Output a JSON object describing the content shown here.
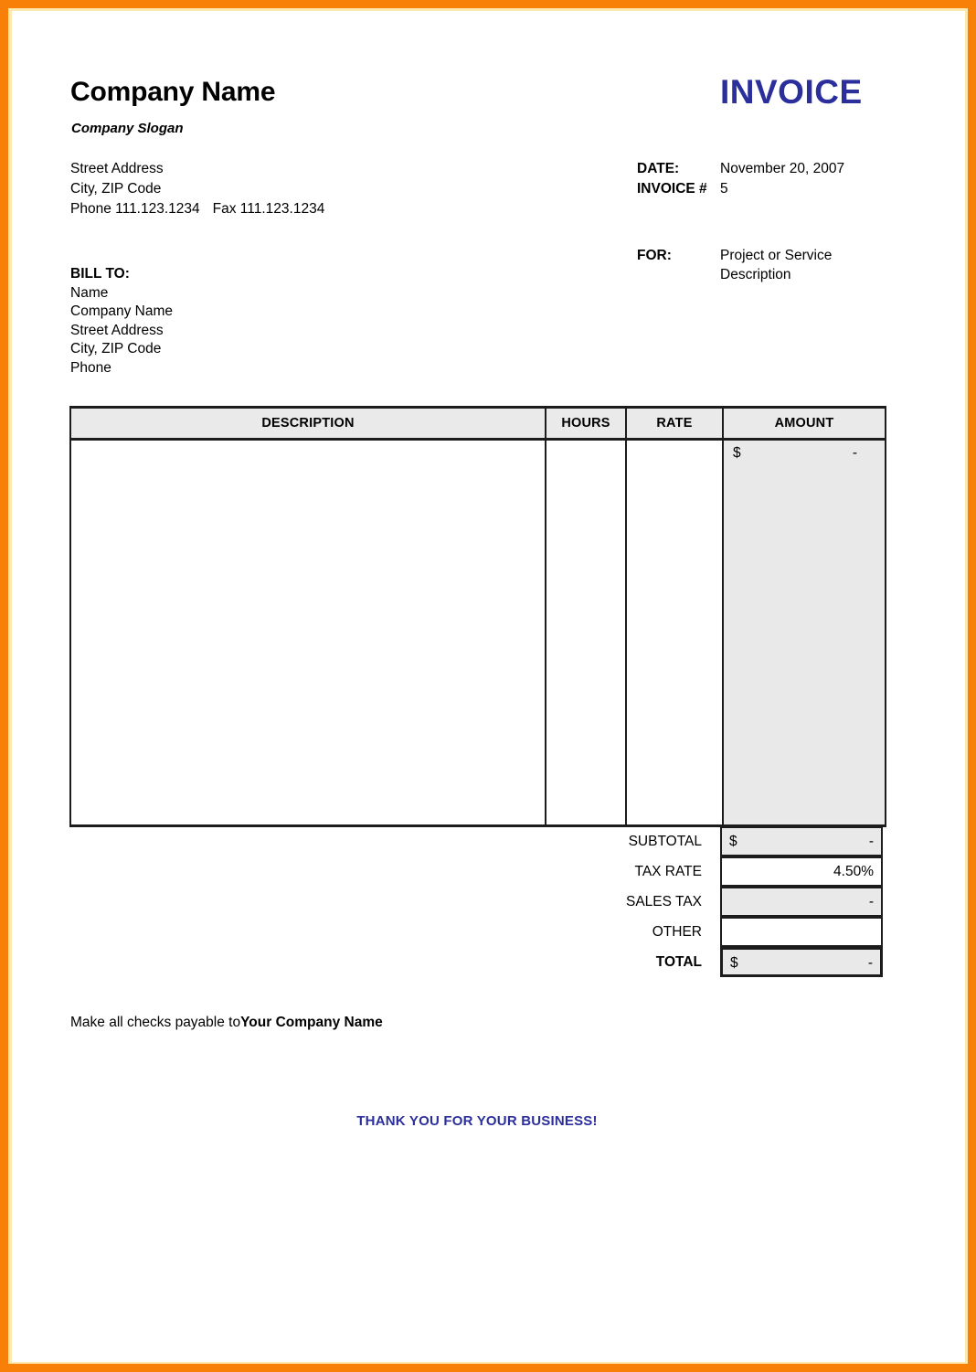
{
  "document": {
    "type": "invoice",
    "accent_orange": "#f98008",
    "accent_blue": "#2b2f9c",
    "shaded_cell_color": "#e9e9e9",
    "header_fill_color": "#eaeaea"
  },
  "header": {
    "company_name": "Company Name",
    "company_slogan": "Company Slogan",
    "invoice_title": "INVOICE",
    "address": {
      "street": "Street Address",
      "city_zip": "City, ZIP Code",
      "phone_label": "Phone 111.123.1234",
      "fax_label": "Fax 111.123.1234"
    }
  },
  "meta": {
    "date_label": "DATE:",
    "date_value": "November 20, 2007",
    "invoice_number_label": "INVOICE #",
    "invoice_number_value": "5"
  },
  "for_block": {
    "label": "FOR:",
    "line1": "Project or Service",
    "line2": "Description"
  },
  "bill_to": {
    "title": "BILL TO:",
    "name": "Name",
    "company": "Company Name",
    "street": "Street Address",
    "city_zip": "City, ZIP Code",
    "phone": "Phone"
  },
  "items_table": {
    "columns": {
      "description": "DESCRIPTION",
      "hours": "HOURS",
      "rate": "RATE",
      "amount": "AMOUNT"
    },
    "rows": [
      {
        "description": "",
        "hours": "",
        "rate": "",
        "amount_currency": "$",
        "amount_value": "-"
      }
    ]
  },
  "totals": {
    "subtotal": {
      "label": "SUBTOTAL",
      "currency": "$",
      "value": "-"
    },
    "tax_rate": {
      "label": "TAX RATE",
      "currency": "",
      "value": "4.50%"
    },
    "sales_tax": {
      "label": "SALES TAX",
      "currency": "",
      "value": "-"
    },
    "other": {
      "label": "OTHER",
      "currency": "",
      "value": ""
    },
    "total": {
      "label": "TOTAL",
      "currency": "$",
      "value": "-"
    }
  },
  "footer": {
    "payable_prefix": "Make all checks payable to",
    "payable_company": "Your Company Name",
    "thank_you": "THANK YOU FOR YOUR BUSINESS!"
  }
}
